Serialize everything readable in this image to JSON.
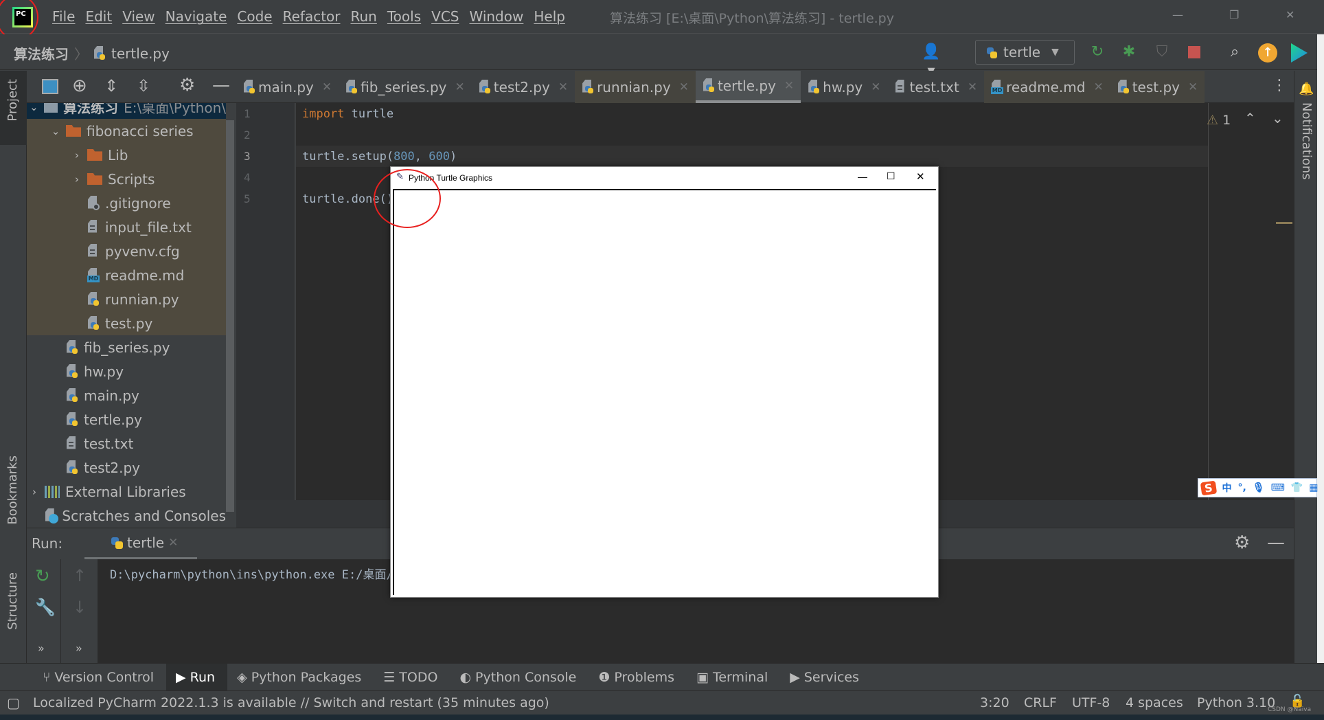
{
  "titlebar": {
    "menu": [
      "File",
      "Edit",
      "View",
      "Navigate",
      "Code",
      "Refactor",
      "Run",
      "Tools",
      "VCS",
      "Window",
      "Help"
    ],
    "title": "算法练习 [E:\\桌面\\Python\\算法练习] - tertle.py",
    "logo_text": "PC"
  },
  "navbar": {
    "project": "算法练习",
    "file": "tertle.py",
    "run_config": "tertle"
  },
  "editor_tabs": [
    {
      "label": "main.py",
      "icon": "python",
      "state": "normal"
    },
    {
      "label": "fib_series.py",
      "icon": "python",
      "state": "normal"
    },
    {
      "label": "test2.py",
      "icon": "python",
      "state": "normal"
    },
    {
      "label": "runnian.py",
      "icon": "python",
      "state": "tinted"
    },
    {
      "label": "tertle.py",
      "icon": "python",
      "state": "active"
    },
    {
      "label": "hw.py",
      "icon": "python",
      "state": "normal"
    },
    {
      "label": "test.txt",
      "icon": "text",
      "state": "normal"
    },
    {
      "label": "readme.md",
      "icon": "markdown",
      "state": "tinted"
    },
    {
      "label": "test.py",
      "icon": "python",
      "state": "tinted"
    }
  ],
  "project": {
    "stripe_label": "Project",
    "root": {
      "label": "算法练习",
      "path": "E:\\桌面\\Python\\"
    },
    "items": [
      {
        "label": "fibonacci series",
        "icon": "folder",
        "depth": 1,
        "chevron": "down",
        "hl": true
      },
      {
        "label": "Lib",
        "icon": "folder",
        "depth": 2,
        "chevron": "right",
        "hl": true
      },
      {
        "label": "Scripts",
        "icon": "folder",
        "depth": 2,
        "chevron": "right",
        "hl": true
      },
      {
        "label": ".gitignore",
        "icon": "gitignore",
        "depth": 2,
        "hl": true
      },
      {
        "label": "input_file.txt",
        "icon": "text",
        "depth": 2,
        "hl": true
      },
      {
        "label": "pyvenv.cfg",
        "icon": "text",
        "depth": 2,
        "hl": true
      },
      {
        "label": "readme.md",
        "icon": "markdown",
        "depth": 2,
        "hl": true
      },
      {
        "label": "runnian.py",
        "icon": "python",
        "depth": 2,
        "hl": true
      },
      {
        "label": "test.py",
        "icon": "python",
        "depth": 2,
        "hl": true
      },
      {
        "label": "fib_series.py",
        "icon": "python",
        "depth": 1
      },
      {
        "label": "hw.py",
        "icon": "python",
        "depth": 1
      },
      {
        "label": "main.py",
        "icon": "python",
        "depth": 1
      },
      {
        "label": "tertle.py",
        "icon": "python",
        "depth": 1
      },
      {
        "label": "test.txt",
        "icon": "text",
        "depth": 1
      },
      {
        "label": "test2.py",
        "icon": "python",
        "depth": 1
      },
      {
        "label": "External Libraries",
        "icon": "libraries",
        "depth": 0,
        "chevron": "right"
      },
      {
        "label": "Scratches and Consoles",
        "icon": "scratches",
        "depth": 0
      }
    ]
  },
  "editor": {
    "lines": [
      [
        {
          "t": "import ",
          "c": "kw"
        },
        {
          "t": "turtle",
          "c": ""
        }
      ],
      [],
      [
        {
          "t": "turtle.setup(",
          "c": ""
        },
        {
          "t": "800",
          "c": "num"
        },
        {
          "t": ", ",
          "c": ""
        },
        {
          "t": "600",
          "c": "num"
        },
        {
          "t": ")",
          "c": ""
        }
      ],
      [],
      [
        {
          "t": "turtle.done()",
          "c": ""
        }
      ]
    ],
    "warnings": "1"
  },
  "turtle_window": {
    "title": "Python Turtle Graphics"
  },
  "run": {
    "label": "Run:",
    "tab": "tertle",
    "output": "D:\\pycharm\\python\\ins\\python.exe E:/桌面/Python/算法练习/tertle.py"
  },
  "left_stripe": {
    "bookmarks": "Bookmarks",
    "structure": "Structure"
  },
  "right_stripe": {
    "notifications": "Notifications"
  },
  "tool_windows": [
    {
      "label": "Version Control",
      "icon": "⑂"
    },
    {
      "label": "Run",
      "icon": "▶",
      "active": true
    },
    {
      "label": "Python Packages",
      "icon": "◈"
    },
    {
      "label": "TODO",
      "icon": "☰"
    },
    {
      "label": "Python Console",
      "icon": "◐"
    },
    {
      "label": "Problems",
      "icon": "❶"
    },
    {
      "label": "Terminal",
      "icon": "▣"
    },
    {
      "label": "Services",
      "icon": "▶"
    }
  ],
  "statusbar": {
    "message": "Localized PyCharm 2022.1.3 is available // Switch and restart (35 minutes ago)",
    "position": "3:20",
    "line_sep": "CRLF",
    "encoding": "UTF-8",
    "indent": "4 spaces",
    "interpreter": "Python 3.10",
    "watermark": "CSDN @Naiva"
  },
  "ime": {
    "mode": "中",
    "punct": "°,"
  },
  "colors": {
    "accent_red_annotation": "#e8201f",
    "keyword": "#cc7832",
    "number": "#6897bb",
    "editor_bg": "#2b2b2b"
  }
}
